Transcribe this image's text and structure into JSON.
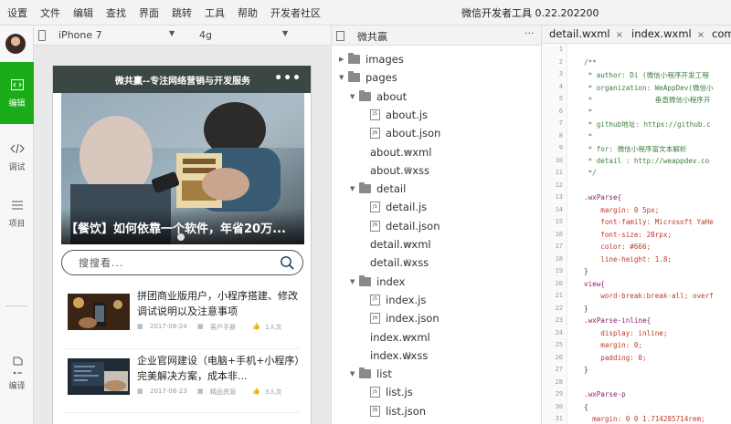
{
  "menu": [
    "设置",
    "文件",
    "编辑",
    "查找",
    "界面",
    "跳转",
    "工具",
    "帮助",
    "开发者社区"
  ],
  "app_title": "微信开发者工具 0.22.202200",
  "activity_bar": {
    "items": [
      {
        "label": "编辑",
        "icon": "code-icon"
      },
      {
        "label": "调试",
        "icon": "debug-icon"
      },
      {
        "label": "项目",
        "icon": "project-icon"
      },
      {
        "label": "编译",
        "icon": "compile-icon"
      }
    ]
  },
  "simulator": {
    "device": "iPhone 7",
    "network": "4g",
    "nav_title": "微共赢--专注网络营销与开发服务",
    "nav_dots": "•••",
    "banner_caption": "【餐饮】如何依靠一个软件，年省20万...",
    "search_placeholder": "搜搜看...",
    "articles": [
      {
        "title": "拼团商业版用户，小程序搭建、修改调试说明以及注意事项",
        "date": "2017-08-24",
        "category": "客户手册",
        "likes": "1人次"
      },
      {
        "title": "企业官网建设（电脑+手机+小程序）完美解决方案，成本非...",
        "date": "2017-08-23",
        "category": "精品资源",
        "likes": "3人次"
      }
    ]
  },
  "file_tree": {
    "title": "微共赢",
    "more": "···",
    "items": [
      {
        "depth": 0,
        "type": "folder",
        "name": "images",
        "open": false
      },
      {
        "depth": 0,
        "type": "folder",
        "name": "pages",
        "open": true
      },
      {
        "depth": 1,
        "type": "folder",
        "name": "about",
        "open": true
      },
      {
        "depth": 2,
        "type": "js",
        "name": "about.js"
      },
      {
        "depth": 2,
        "type": "json",
        "name": "about.json"
      },
      {
        "depth": 2,
        "type": "code",
        "name": "about.wxml"
      },
      {
        "depth": 2,
        "type": "style",
        "name": "about.wxss"
      },
      {
        "depth": 1,
        "type": "folder",
        "name": "detail",
        "open": true
      },
      {
        "depth": 2,
        "type": "js",
        "name": "detail.js"
      },
      {
        "depth": 2,
        "type": "json",
        "name": "detail.json"
      },
      {
        "depth": 2,
        "type": "code",
        "name": "detail.wxml"
      },
      {
        "depth": 2,
        "type": "style",
        "name": "detail.wxss"
      },
      {
        "depth": 1,
        "type": "folder",
        "name": "index",
        "open": true
      },
      {
        "depth": 2,
        "type": "js",
        "name": "index.js"
      },
      {
        "depth": 2,
        "type": "json",
        "name": "index.json"
      },
      {
        "depth": 2,
        "type": "code",
        "name": "index.wxml"
      },
      {
        "depth": 2,
        "type": "style",
        "name": "index.wxss"
      },
      {
        "depth": 1,
        "type": "folder",
        "name": "list",
        "open": true
      },
      {
        "depth": 2,
        "type": "js",
        "name": "list.js"
      },
      {
        "depth": 2,
        "type": "json",
        "name": "list.json"
      }
    ]
  },
  "editor": {
    "tabs": [
      {
        "label": "detail.wxml",
        "close": "×"
      },
      {
        "label": "index.wxml",
        "close": "×"
      },
      {
        "label": "com"
      }
    ],
    "lines": [
      {
        "n": "1",
        "t": "",
        "c": "plain"
      },
      {
        "n": "2",
        "t": "/**",
        "c": "com"
      },
      {
        "n": "3",
        "t": " * author: Di (微信小程序开发工程",
        "c": "com"
      },
      {
        "n": "4",
        "t": " * organization: WeAppDev(微信小",
        "c": "com"
      },
      {
        "n": "5",
        "t": " *               垂直微信小程序开",
        "c": "com"
      },
      {
        "n": "6",
        "t": " *",
        "c": "com"
      },
      {
        "n": "7",
        "t": " * github地址: https://github.c",
        "c": "com"
      },
      {
        "n": "8",
        "t": " *",
        "c": "com"
      },
      {
        "n": "9",
        "t": " * for: 微信小程序富文本解析",
        "c": "com"
      },
      {
        "n": "10",
        "t": " * detail : http://weappdev.co",
        "c": "com"
      },
      {
        "n": "11",
        "t": " */",
        "c": "com"
      },
      {
        "n": "12",
        "t": "",
        "c": "plain"
      },
      {
        "n": "13",
        "t": ".wxParse{",
        "c": "sel"
      },
      {
        "n": "14",
        "t": "    margin: 0 5px;",
        "c": "prop"
      },
      {
        "n": "15",
        "t": "    font-family: Microsoft YaHe",
        "c": "prop"
      },
      {
        "n": "16",
        "t": "    font-size: 28rpx;",
        "c": "prop"
      },
      {
        "n": "17",
        "t": "    color: #666;",
        "c": "prop"
      },
      {
        "n": "18",
        "t": "    line-height: 1.8;",
        "c": "prop"
      },
      {
        "n": "19",
        "t": "}",
        "c": "plain"
      },
      {
        "n": "20",
        "t": "view{",
        "c": "sel"
      },
      {
        "n": "21",
        "t": "    word-break:break-all; overf",
        "c": "prop"
      },
      {
        "n": "22",
        "t": "}",
        "c": "plain"
      },
      {
        "n": "23",
        "t": ".wxParse-inline{",
        "c": "sel"
      },
      {
        "n": "24",
        "t": "    display: inline;",
        "c": "prop"
      },
      {
        "n": "25",
        "t": "    margin: 0;",
        "c": "prop"
      },
      {
        "n": "26",
        "t": "    padding: 0;",
        "c": "prop"
      },
      {
        "n": "27",
        "t": "}",
        "c": "plain"
      },
      {
        "n": "28",
        "t": "",
        "c": "plain"
      },
      {
        "n": "29",
        "t": ".wxParse-p",
        "c": "sel"
      },
      {
        "n": "30",
        "t": "{",
        "c": "plain"
      },
      {
        "n": "31",
        "t": "  margin: 0 0 1.714285714rem;",
        "c": "prop"
      }
    ]
  }
}
